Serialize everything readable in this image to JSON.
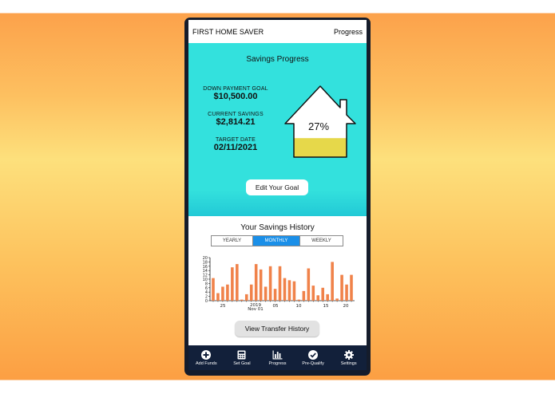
{
  "appbar": {
    "title": "FIRST HOME SAVER",
    "right": "Progress"
  },
  "hero": {
    "title": "Savings Progress",
    "goal_label": "DOWN PAYMENT GOAL",
    "goal_value": "$10,500.00",
    "savings_label": "CURRENT SAVINGS",
    "savings_value": "$2,814.21",
    "date_label": "TARGET DATE",
    "date_value": "02/11/2021",
    "progress_text": "27%",
    "progress_fraction": 0.27,
    "edit_button": "Edit Your Goal"
  },
  "history": {
    "title": "Your Savings History",
    "tabs": [
      "YEARLY",
      "MONTHLY",
      "WEEKLY"
    ],
    "selected_tab": "MONTHLY",
    "transfer_button": "View Transfer History"
  },
  "chart_data": {
    "type": "bar",
    "x_tick_labels": [
      "25",
      "2019",
      "Nov 01",
      "05",
      "10",
      "15",
      "20"
    ],
    "y_ticks": [
      0,
      2,
      4,
      6,
      8,
      10,
      12,
      14,
      16,
      18,
      20
    ],
    "ylim": [
      0,
      20
    ],
    "values": [
      10.5,
      3.5,
      6.5,
      7.5,
      15.5,
      17.0,
      0.5,
      3.0,
      7.5,
      17.0,
      14.5,
      6.5,
      16.0,
      5.5,
      16.0,
      10.5,
      9.5,
      9.0,
      0.5,
      4.5,
      15.0,
      7.0,
      2.5,
      6.0,
      3.0,
      18.0,
      1.0,
      12.0,
      7.5,
      12.0
    ],
    "bar_color": "#f0824a"
  },
  "tabbar": [
    {
      "label": "Add Funds",
      "icon": "plus-circle-icon"
    },
    {
      "label": "Set Goal",
      "icon": "calculator-icon"
    },
    {
      "label": "Progress",
      "icon": "bar-chart-icon"
    },
    {
      "label": "Pre-Qualify",
      "icon": "check-circle-icon"
    },
    {
      "label": "Settings",
      "icon": "gear-icon"
    }
  ],
  "colors": {
    "hero": "#33e1dd",
    "accent": "#1a8fe8",
    "fill": "#e6d84a",
    "tabbar": "#12203a"
  }
}
